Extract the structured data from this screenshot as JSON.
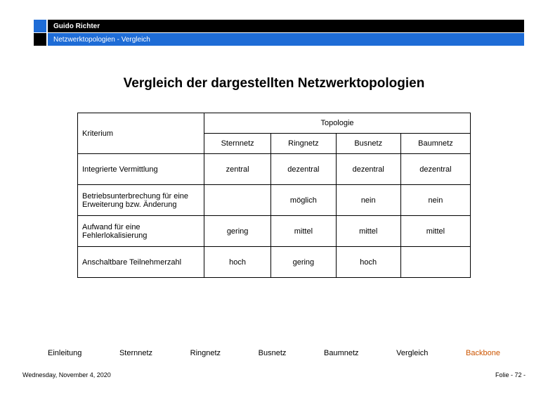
{
  "header": {
    "author": "Guido Richter",
    "subtitle": "Netzwerktopologien  - Vergleich"
  },
  "title": "Vergleich der dargestellten Netzwerktopologien",
  "table": {
    "criterion_label": "Kriterium",
    "topology_label": "Topologie",
    "columns": [
      "Sternnetz",
      "Ringnetz",
      "Busnetz",
      "Baumnetz"
    ],
    "rows": [
      {
        "label": "Integrierte Vermittlung",
        "values": [
          "zentral",
          "dezentral",
          "dezentral",
          "dezentral"
        ]
      },
      {
        "label": "Betriebsunterbrechung für eine Erweiterung bzw. Änderung",
        "values": [
          "",
          "möglich",
          "nein",
          "nein"
        ]
      },
      {
        "label": "Aufwand für eine Fehlerlokalisierung",
        "values": [
          "gering",
          "mittel",
          "mittel",
          "mittel"
        ]
      },
      {
        "label": "Anschaltbare Teilnehmerzahl",
        "values": [
          "hoch",
          "gering",
          "hoch",
          ""
        ]
      }
    ]
  },
  "nav": {
    "items": [
      "Einleitung",
      "Sternnetz",
      "Ringnetz",
      "Busnetz",
      "Baumnetz",
      "Vergleich",
      "Backbone"
    ]
  },
  "footer": {
    "date": "Wednesday, November 4, 2020",
    "page": "Folie - 72 -"
  }
}
